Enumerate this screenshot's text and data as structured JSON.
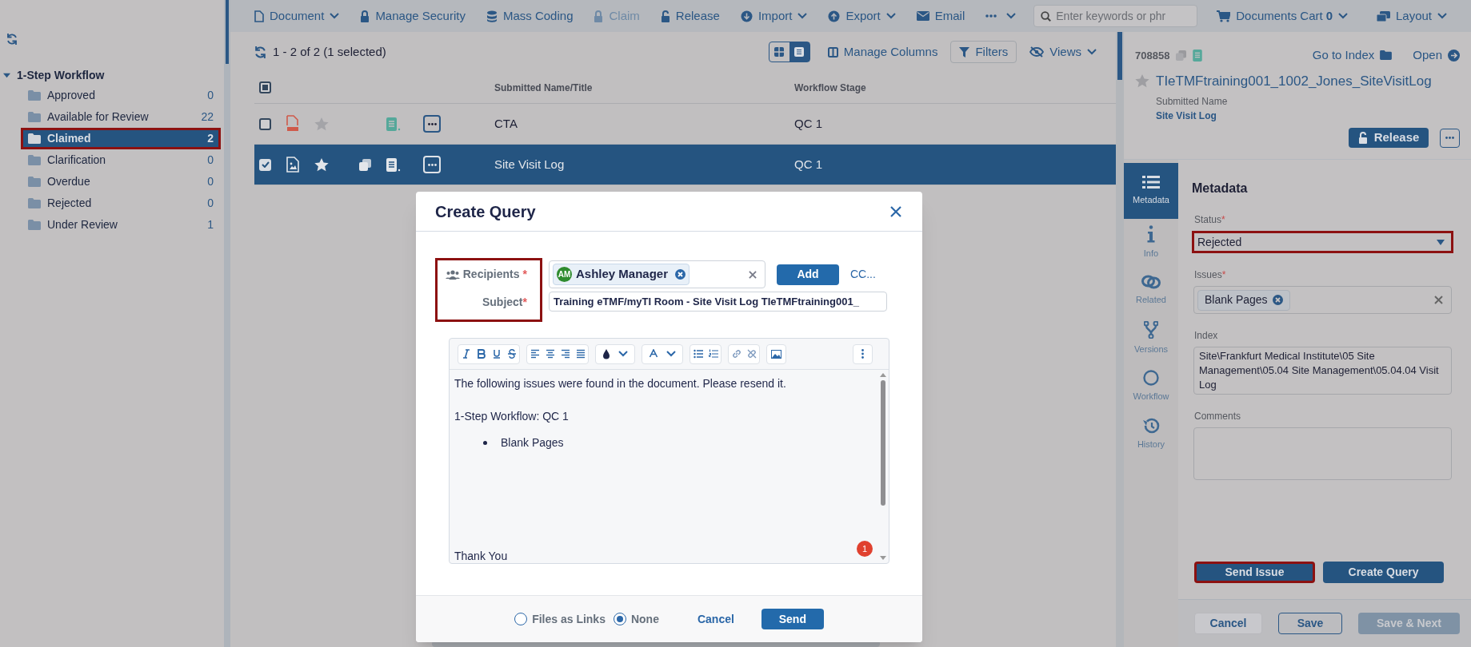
{
  "toolbar": {
    "items": [
      {
        "label": "Document",
        "dropdown": true,
        "disabled": false
      },
      {
        "label": "Manage Security",
        "dropdown": false,
        "disabled": false
      },
      {
        "label": "Mass Coding",
        "dropdown": false,
        "disabled": false
      },
      {
        "label": "Claim",
        "dropdown": false,
        "disabled": true
      },
      {
        "label": "Release",
        "dropdown": false,
        "disabled": false
      },
      {
        "label": "Import",
        "dropdown": true,
        "disabled": false
      },
      {
        "label": "Export",
        "dropdown": true,
        "disabled": false
      },
      {
        "label": "Email",
        "dropdown": false,
        "disabled": false
      }
    ],
    "search": {
      "placeholder": "Enter keywords or phr"
    },
    "cart": {
      "label": "Documents Cart",
      "count": "0"
    },
    "layout": {
      "label": "Layout"
    }
  },
  "sidebar": {
    "tree": [
      {
        "label": "1-Step Workflow",
        "expanded": true,
        "children": [
          {
            "label": "Approved",
            "count": "0",
            "selected": false,
            "highlighted": false
          },
          {
            "label": "Available for Review",
            "count": "22",
            "selected": false,
            "highlighted": false
          },
          {
            "label": "Claimed",
            "count": "2",
            "selected": true,
            "highlighted": true
          },
          {
            "label": "Clarification",
            "count": "0",
            "selected": false,
            "highlighted": false
          },
          {
            "label": "Overdue",
            "count": "0",
            "selected": false,
            "highlighted": false
          },
          {
            "label": "Rejected",
            "count": "0",
            "selected": false,
            "highlighted": false
          },
          {
            "label": "Under Review",
            "count": "1",
            "selected": false,
            "highlighted": false
          }
        ]
      }
    ]
  },
  "list": {
    "summary": "1 - 2 of 2 (1 selected)",
    "view_modes": [
      {
        "kind": "grid",
        "selected": false
      },
      {
        "kind": "list",
        "selected": true
      }
    ],
    "manage_columns": "Manage Columns",
    "filters": "Filters",
    "views": "Views"
  },
  "table": {
    "select_all_partial": true,
    "columns": [
      "Submitted Name/Title",
      "Workflow Stage"
    ],
    "rows": [
      {
        "kind": "pdf",
        "has_copy": false,
        "checked": false,
        "selected": false,
        "cells": [
          "CTA",
          "QC 1"
        ]
      },
      {
        "kind": "image",
        "has_copy": true,
        "checked": true,
        "selected": true,
        "cells": [
          "Site Visit Log",
          "QC 1"
        ]
      }
    ]
  },
  "detail": {
    "doc_id": "708858",
    "go_to_index": "Go to Index",
    "open": "Open",
    "title": "TIeTMFtraining001_1002_Jones_SiteVisitLog",
    "submitted_name_label": "Submitted Name",
    "submitted_name": "Site Visit Log",
    "release": "Release",
    "tabs": [
      {
        "label": "Metadata",
        "selected": true
      },
      {
        "label": "Info",
        "selected": false
      },
      {
        "label": "Related",
        "selected": false
      },
      {
        "label": "Versions",
        "selected": false
      },
      {
        "label": "Workflow",
        "selected": false
      },
      {
        "label": "History",
        "selected": false
      }
    ],
    "section_title": "Metadata",
    "fields": [
      {
        "kind": "select",
        "label": "Status",
        "required_mark": "*",
        "value": "Rejected",
        "highlighted": true
      },
      {
        "kind": "tags",
        "label": "Issues",
        "required_mark": "*",
        "tags": [
          "Blank Pages"
        ],
        "highlighted": false
      },
      {
        "kind": "text",
        "label": "Index",
        "value": "Site\\Frankfurt Medical Institute\\05 Site Management\\05.04 Site Management\\05.04.04 Visit Log",
        "highlighted": false
      },
      {
        "kind": "textarea",
        "label": "Comments",
        "highlighted": false
      }
    ],
    "actions": [
      {
        "label": "Send Issue",
        "highlighted": true
      },
      {
        "label": "Create Query",
        "highlighted": false
      }
    ],
    "footer": [
      {
        "label": "Cancel",
        "kind": "secondary",
        "disabled": false
      },
      {
        "label": "Save",
        "kind": "outline",
        "disabled": false
      },
      {
        "label": "Save & Next",
        "kind": "primary",
        "disabled": true
      }
    ]
  },
  "dialog": {
    "title": "Create Query",
    "labels_highlighted": true,
    "recipients": {
      "label": "Recipients",
      "required_mark": "*",
      "chips": [
        {
          "initials": "AM",
          "name": "Ashley Manager"
        }
      ]
    },
    "add": "Add",
    "cc": "CC...",
    "subject": {
      "label": "Subject",
      "required_mark": "*",
      "value": "Training eTMF/myTI Room - Site Visit Log TIeTMFtraining001_"
    },
    "body": [
      {
        "kind": "paragraph",
        "text": "The following issues were found in the document. Please resend it."
      },
      {
        "kind": "paragraph",
        "text": "1-Step Workflow: QC 1"
      },
      {
        "kind": "bullets",
        "items": [
          "Blank Pages"
        ]
      },
      {
        "kind": "signature",
        "text": "Thank You"
      }
    ],
    "badge": "1",
    "attach_options": [
      {
        "label": "Files as Links",
        "selected": false
      },
      {
        "label": "None",
        "selected": true
      }
    ],
    "cancel": "Cancel",
    "send": "Send"
  }
}
